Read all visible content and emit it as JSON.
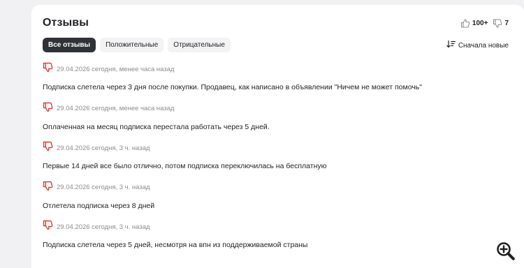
{
  "section": {
    "title": "Отзывы",
    "likes_count": "100+",
    "dislikes_count": "7"
  },
  "tabs": [
    {
      "label": "Все отзывы",
      "active": true
    },
    {
      "label": "Положительные",
      "active": false
    },
    {
      "label": "Отрицательные",
      "active": false
    }
  ],
  "sort": {
    "label": "Сначала новые",
    "icon": "sort-icon"
  },
  "reviews": [
    {
      "meta": "29.04.2026 сегодня, менее часа назад",
      "text": "Подписка слетела через 3 дня после покупки. Продавец, как написано в объявлении \"Ничем не может помочь\"",
      "rating_icon": "thumb-down-icon"
    },
    {
      "meta": "29.04.2026 сегодня, менее часа назад",
      "text": "Оплаченная на месяц подписка перестала работать через 5 дней.",
      "rating_icon": "thumb-down-icon"
    },
    {
      "meta": "29.04.2026 сегодня, 3 ч. назад",
      "text": "Первые 14 дней все было отлично, потом подписка переключилась на бесплатную",
      "rating_icon": "thumb-down-icon"
    },
    {
      "meta": "29.04.2026 сегодня, 3 ч. назад",
      "text": "Отлетела подписка через 8 дней",
      "rating_icon": "thumb-down-icon"
    },
    {
      "meta": "29.04.2026 сегодня, 3 ч. назад",
      "text": "Подписка слетела через 5 дней, несмотря на впн из поддерживаемой страны",
      "rating_icon": "thumb-down-icon"
    }
  ],
  "colors": {
    "negative": "#e23b3b",
    "active_tab_bg": "#2f3236",
    "tab_bg": "#f3f3f5",
    "meta_text": "#8b8c92"
  }
}
